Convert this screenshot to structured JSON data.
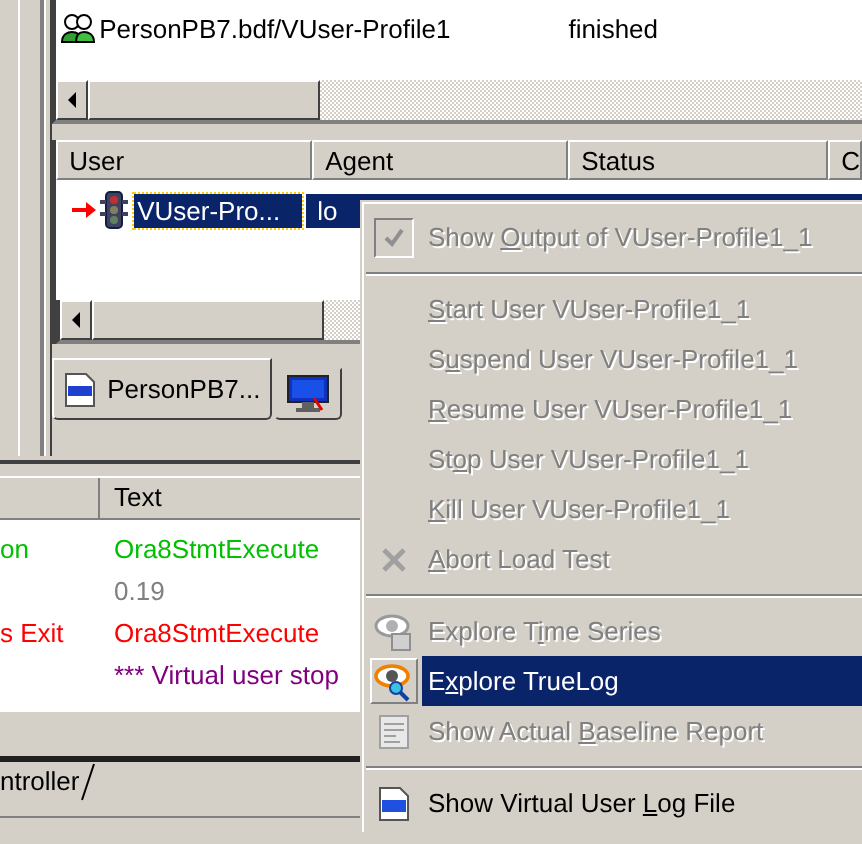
{
  "top_list": {
    "rows": [
      {
        "name": "PersonPB7.bdf/VUser-Profile1",
        "status": "finished"
      }
    ]
  },
  "user_list": {
    "columns": [
      "User",
      "Agent",
      "Status",
      "C"
    ],
    "rows": [
      {
        "user": "VUser-Pro...",
        "agent": "lo",
        "selected": true
      }
    ]
  },
  "tabs": [
    {
      "label": "PersonPB7...",
      "selected": true
    },
    {
      "selected": false
    }
  ],
  "log": {
    "columns": [
      "",
      "Text"
    ],
    "rows": [
      {
        "column_1": "on",
        "text": "Ora8StmtExecute",
        "color": "#00c000"
      },
      {
        "text": "0.19",
        "color": "#808080"
      },
      {
        "column_1": "s Exit",
        "text": "Ora8StmtExecute",
        "color": "#ff0000"
      },
      {
        "text": "*** Virtual user stop",
        "color": "#800080"
      }
    ]
  },
  "bottom_tabs": [
    {
      "label": "ntroller"
    }
  ],
  "context_menu": {
    "items": [
      {
        "kind": "item",
        "label": {
          "before": "Show ",
          "key": "O",
          "after": "utput of VUser-Profile1_1"
        },
        "checked": true,
        "disabled": true,
        "selected": false
      },
      {
        "kind": "separator"
      },
      {
        "kind": "item",
        "label": {
          "key": "S",
          "after": "tart User VUser-Profile1_1"
        },
        "disabled": true,
        "selected": false
      },
      {
        "kind": "item",
        "label": {
          "before": "S",
          "key": "u",
          "after": "spend User VUser-Profile1_1"
        },
        "disabled": true,
        "selected": false
      },
      {
        "kind": "item",
        "label": {
          "key": "R",
          "after": "esume User VUser-Profile1_1"
        },
        "disabled": true,
        "selected": false
      },
      {
        "kind": "item",
        "label": {
          "before": "St",
          "key": "o",
          "after": "p User VUser-Profile1_1"
        },
        "disabled": true,
        "selected": false
      },
      {
        "kind": "item",
        "label": {
          "key": "K",
          "after": "ill User VUser-Profile1_1"
        },
        "disabled": true,
        "selected": false
      },
      {
        "kind": "item",
        "label": {
          "key": "A",
          "after": "bort Load Test"
        },
        "disabled": true,
        "selected": false
      },
      {
        "kind": "separator"
      },
      {
        "kind": "item",
        "label": {
          "before": "Explore T",
          "key": "i",
          "after": "me Series"
        },
        "disabled": true,
        "selected": false
      },
      {
        "kind": "item",
        "label": {
          "before": "E",
          "key": "x",
          "after": "plore TrueLog"
        },
        "disabled": false,
        "selected": true
      },
      {
        "kind": "item",
        "label": {
          "before": "Show Actual ",
          "key": "B",
          "after": "aseline Report"
        },
        "disabled": true,
        "selected": false
      },
      {
        "kind": "separator"
      },
      {
        "kind": "item",
        "label": {
          "before": "Show Virtual User ",
          "key": "L",
          "after": "og File"
        },
        "disabled": false,
        "selected": false
      }
    ]
  }
}
